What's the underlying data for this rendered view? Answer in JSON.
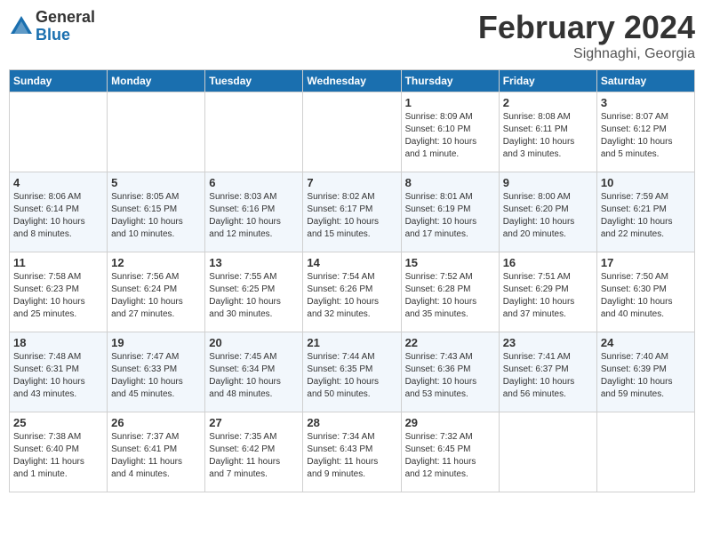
{
  "header": {
    "logo_general": "General",
    "logo_blue": "Blue",
    "title": "February 2024",
    "subtitle": "Sighnaghi, Georgia"
  },
  "weekdays": [
    "Sunday",
    "Monday",
    "Tuesday",
    "Wednesday",
    "Thursday",
    "Friday",
    "Saturday"
  ],
  "weeks": [
    [
      {
        "day": "",
        "info": ""
      },
      {
        "day": "",
        "info": ""
      },
      {
        "day": "",
        "info": ""
      },
      {
        "day": "",
        "info": ""
      },
      {
        "day": "1",
        "info": "Sunrise: 8:09 AM\nSunset: 6:10 PM\nDaylight: 10 hours\nand 1 minute."
      },
      {
        "day": "2",
        "info": "Sunrise: 8:08 AM\nSunset: 6:11 PM\nDaylight: 10 hours\nand 3 minutes."
      },
      {
        "day": "3",
        "info": "Sunrise: 8:07 AM\nSunset: 6:12 PM\nDaylight: 10 hours\nand 5 minutes."
      }
    ],
    [
      {
        "day": "4",
        "info": "Sunrise: 8:06 AM\nSunset: 6:14 PM\nDaylight: 10 hours\nand 8 minutes."
      },
      {
        "day": "5",
        "info": "Sunrise: 8:05 AM\nSunset: 6:15 PM\nDaylight: 10 hours\nand 10 minutes."
      },
      {
        "day": "6",
        "info": "Sunrise: 8:03 AM\nSunset: 6:16 PM\nDaylight: 10 hours\nand 12 minutes."
      },
      {
        "day": "7",
        "info": "Sunrise: 8:02 AM\nSunset: 6:17 PM\nDaylight: 10 hours\nand 15 minutes."
      },
      {
        "day": "8",
        "info": "Sunrise: 8:01 AM\nSunset: 6:19 PM\nDaylight: 10 hours\nand 17 minutes."
      },
      {
        "day": "9",
        "info": "Sunrise: 8:00 AM\nSunset: 6:20 PM\nDaylight: 10 hours\nand 20 minutes."
      },
      {
        "day": "10",
        "info": "Sunrise: 7:59 AM\nSunset: 6:21 PM\nDaylight: 10 hours\nand 22 minutes."
      }
    ],
    [
      {
        "day": "11",
        "info": "Sunrise: 7:58 AM\nSunset: 6:23 PM\nDaylight: 10 hours\nand 25 minutes."
      },
      {
        "day": "12",
        "info": "Sunrise: 7:56 AM\nSunset: 6:24 PM\nDaylight: 10 hours\nand 27 minutes."
      },
      {
        "day": "13",
        "info": "Sunrise: 7:55 AM\nSunset: 6:25 PM\nDaylight: 10 hours\nand 30 minutes."
      },
      {
        "day": "14",
        "info": "Sunrise: 7:54 AM\nSunset: 6:26 PM\nDaylight: 10 hours\nand 32 minutes."
      },
      {
        "day": "15",
        "info": "Sunrise: 7:52 AM\nSunset: 6:28 PM\nDaylight: 10 hours\nand 35 minutes."
      },
      {
        "day": "16",
        "info": "Sunrise: 7:51 AM\nSunset: 6:29 PM\nDaylight: 10 hours\nand 37 minutes."
      },
      {
        "day": "17",
        "info": "Sunrise: 7:50 AM\nSunset: 6:30 PM\nDaylight: 10 hours\nand 40 minutes."
      }
    ],
    [
      {
        "day": "18",
        "info": "Sunrise: 7:48 AM\nSunset: 6:31 PM\nDaylight: 10 hours\nand 43 minutes."
      },
      {
        "day": "19",
        "info": "Sunrise: 7:47 AM\nSunset: 6:33 PM\nDaylight: 10 hours\nand 45 minutes."
      },
      {
        "day": "20",
        "info": "Sunrise: 7:45 AM\nSunset: 6:34 PM\nDaylight: 10 hours\nand 48 minutes."
      },
      {
        "day": "21",
        "info": "Sunrise: 7:44 AM\nSunset: 6:35 PM\nDaylight: 10 hours\nand 50 minutes."
      },
      {
        "day": "22",
        "info": "Sunrise: 7:43 AM\nSunset: 6:36 PM\nDaylight: 10 hours\nand 53 minutes."
      },
      {
        "day": "23",
        "info": "Sunrise: 7:41 AM\nSunset: 6:37 PM\nDaylight: 10 hours\nand 56 minutes."
      },
      {
        "day": "24",
        "info": "Sunrise: 7:40 AM\nSunset: 6:39 PM\nDaylight: 10 hours\nand 59 minutes."
      }
    ],
    [
      {
        "day": "25",
        "info": "Sunrise: 7:38 AM\nSunset: 6:40 PM\nDaylight: 11 hours\nand 1 minute."
      },
      {
        "day": "26",
        "info": "Sunrise: 7:37 AM\nSunset: 6:41 PM\nDaylight: 11 hours\nand 4 minutes."
      },
      {
        "day": "27",
        "info": "Sunrise: 7:35 AM\nSunset: 6:42 PM\nDaylight: 11 hours\nand 7 minutes."
      },
      {
        "day": "28",
        "info": "Sunrise: 7:34 AM\nSunset: 6:43 PM\nDaylight: 11 hours\nand 9 minutes."
      },
      {
        "day": "29",
        "info": "Sunrise: 7:32 AM\nSunset: 6:45 PM\nDaylight: 11 hours\nand 12 minutes."
      },
      {
        "day": "",
        "info": ""
      },
      {
        "day": "",
        "info": ""
      }
    ]
  ]
}
